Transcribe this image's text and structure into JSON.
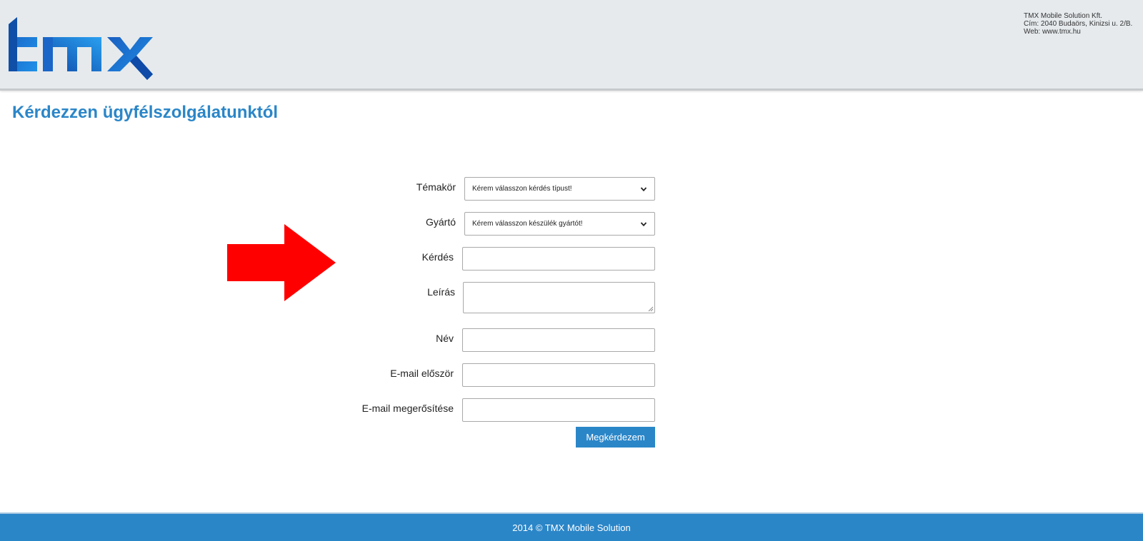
{
  "header": {
    "logo_alt": "tmx",
    "company": {
      "name": "TMX Mobile Solution Kft.",
      "address": "Cím: 2040 Budaörs, Kinizsi u. 2/B.",
      "web": "Web: www.tmx.hu"
    }
  },
  "page": {
    "title": "Kérdezzen ügyfélszolgálatunktól"
  },
  "form": {
    "topic_label": "Témakör",
    "topic_selected": "Kérem válasszon kérdés típust!",
    "manufacturer_label": "Gyártó",
    "manufacturer_selected": "Kérem válasszon készülék gyártót!",
    "question_label": "Kérdés",
    "question_value": "",
    "description_label": "Leírás",
    "description_value": "",
    "name_label": "Név",
    "name_value": "",
    "email_label": "E-mail először",
    "email_value": "",
    "email_confirm_label": "E-mail megerősítése",
    "email_confirm_value": "",
    "submit_label": "Megkérdezem"
  },
  "footer": {
    "text": "2014 © TMX Mobile Solution"
  },
  "colors": {
    "accent": "#2b86c8",
    "header_bg": "#e6eaed",
    "arrow": "#ff0000"
  },
  "icons": {
    "arrow": "arrow-right-icon",
    "select": "chevron-down-icon"
  }
}
